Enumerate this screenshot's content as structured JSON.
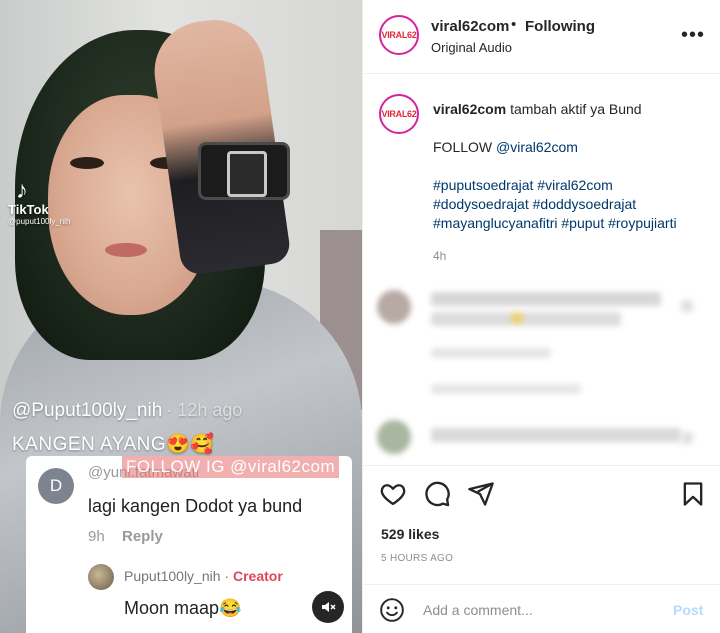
{
  "media": {
    "tiktok": {
      "name": "TikTok",
      "user": "@puput100ly_nih"
    },
    "overlay_user": "@Puput100ly_nih",
    "overlay_ago": "· 12h ago",
    "overlay_caption": "KANGEN AYANG😍🥰",
    "comment": {
      "avatar_letter": "D",
      "reply_to": "@yuni.fatmawati",
      "watermark": "FOLLOW IG @viral62com",
      "text": "lagi kangen Dodot ya bund",
      "time": "9h",
      "reply_label": "Reply",
      "creator_name": "Puput100ly_nih",
      "creator_dot": " · ",
      "creator_tag": "Creator",
      "creator_reply": "Moon maap😂"
    },
    "mute_icon": "speaker-muted-icon"
  },
  "header": {
    "avatar_text": "VIRAL62",
    "username": "viral62com",
    "dot": "•",
    "follow_status": "Following",
    "audio": "Original Audio",
    "more": "•••"
  },
  "caption": {
    "avatar_text": "VIRAL62",
    "username": "viral62com",
    "text": "tambah aktif ya Bund",
    "follow_prefix": "FOLLOW ",
    "follow_handle": "@viral62com",
    "hashtags": [
      "#puputsoedrajat #viral62com",
      "#dodysoedrajat #doddysoedrajat",
      "#mayanglucyanafitri #puput #roypujiarti"
    ],
    "time": "4h"
  },
  "actions": {
    "icons": [
      "heart-icon",
      "comment-icon",
      "share-icon",
      "bookmark-icon"
    ],
    "likes": "529 likes",
    "posted": "5 HOURS AGO"
  },
  "add_comment": {
    "placeholder": "Add a comment...",
    "post_label": "Post",
    "emoji_icon": "smiley-icon"
  }
}
